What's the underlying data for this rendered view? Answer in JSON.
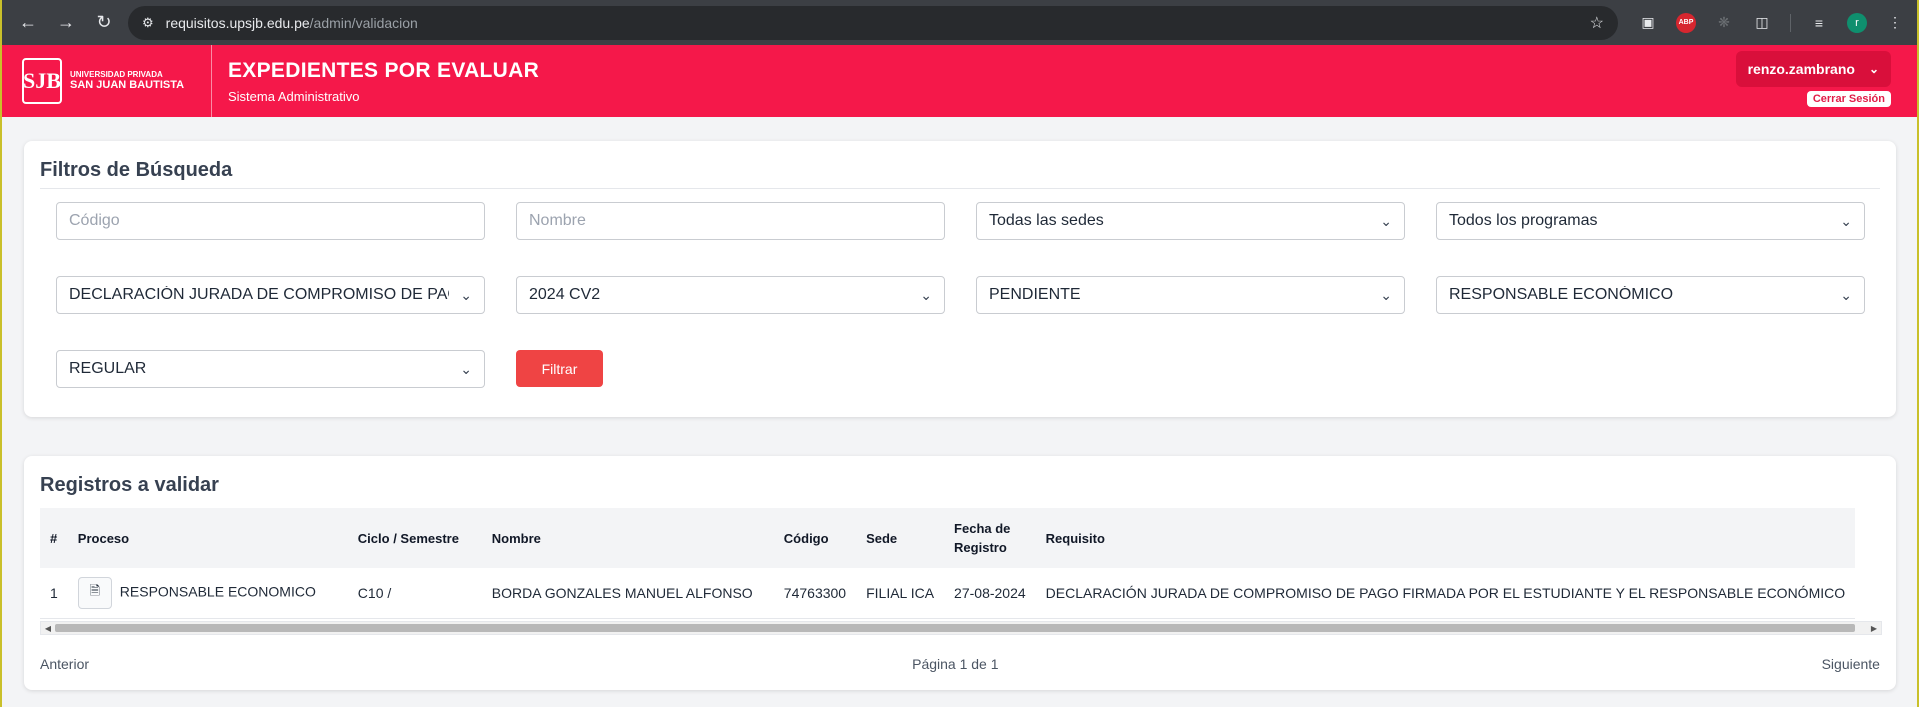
{
  "browser": {
    "url_host": "requisitos.upsjb.edu.pe",
    "url_path": "/admin/validacion",
    "profile_initial": "r"
  },
  "header": {
    "logo_small": "UNIVERSIDAD PRIVADA",
    "logo_big": "SAN JUAN BAUTISTA",
    "logo_mark": "SJB",
    "title": "EXPEDIENTES POR EVALUAR",
    "subtitle": "Sistema Administrativo",
    "user": "renzo.zambrano",
    "logout": "Cerrar Sesión"
  },
  "filters": {
    "title": "Filtros de Búsqueda",
    "codigo_placeholder": "Código",
    "nombre_placeholder": "Nombre",
    "sede": "Todas las sedes",
    "programa": "Todos los programas",
    "requisito": "DECLARACIÓN JURADA DE COMPROMISO DE PAGO FIRMADA",
    "periodo": "2024 CV2",
    "estado": "PENDIENTE",
    "responsable": "RESPONSABLE ECONÓMICO",
    "modalidad": "REGULAR",
    "filter_button": "Filtrar"
  },
  "records": {
    "title": "Registros a validar",
    "columns": {
      "num": "#",
      "proceso": "Proceso",
      "ciclo": "Ciclo / Semestre",
      "nombre": "Nombre",
      "codigo": "Código",
      "sede": "Sede",
      "fecha_1": "Fecha de",
      "fecha_2": "Registro",
      "requisito": "Requisito"
    },
    "rows": [
      {
        "num": "1",
        "proceso": "RESPONSABLE ECONOMICO",
        "ciclo": "C10 /",
        "nombre": "BORDA GONZALES MANUEL ALFONSO",
        "codigo": "74763300",
        "sede": "FILIAL ICA",
        "fecha": "27-08-2024",
        "requisito": "DECLARACIÓN JURADA DE COMPROMISO DE PAGO FIRMADA POR EL ESTUDIANTE Y EL RESPONSABLE ECONÓMICO"
      }
    ],
    "pager": {
      "prev": "Anterior",
      "info": "Página 1 de 1",
      "next": "Siguiente"
    }
  },
  "colors": {
    "brand": "#f5184a",
    "filter_button": "#ef4444"
  }
}
